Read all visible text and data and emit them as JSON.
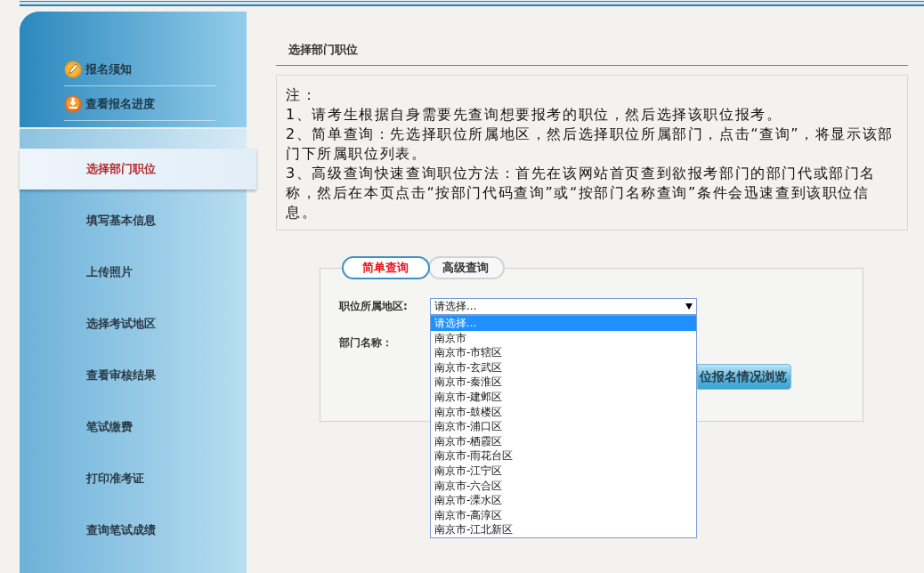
{
  "sidebar": {
    "top_links": [
      {
        "label": "报名须知",
        "kind": "pencil"
      },
      {
        "label": "查看报名进度",
        "kind": "download"
      }
    ],
    "items": [
      {
        "label": "选择部门职位",
        "selected": true
      },
      {
        "label": "填写基本信息",
        "selected": false
      },
      {
        "label": "上传照片",
        "selected": false
      },
      {
        "label": "选择考试地区",
        "selected": false
      },
      {
        "label": "查看审核结果",
        "selected": false
      },
      {
        "label": "笔试缴费",
        "selected": false
      },
      {
        "label": "打印准考证",
        "selected": false
      },
      {
        "label": "查询笔试成绩",
        "selected": false
      }
    ]
  },
  "main": {
    "title": "选择部门职位",
    "notes": {
      "heading": "注：",
      "items": [
        "1、请考生根据自身需要先查询想要报考的职位，然后选择该职位报考。",
        "2、简单查询：先选择职位所属地区，然后选择职位所属部门，点击“查询”，将显示该部门下所属职位列表。",
        "3、高级查询快速查询职位方法：首先在该网站首页查到欲报考部门的部门代或部门名称，然后在本页点击“按部门代码查询”或“按部门名称查询”条件会迅速查到该职位信息。"
      ]
    },
    "query": {
      "tabs": [
        {
          "label": "简单查询",
          "selected": true
        },
        {
          "label": "高级查询",
          "selected": false
        }
      ],
      "region_label": "职位所属地区:",
      "region_value": "请选择...",
      "department_label": "部门名称：",
      "button": "位报名情况浏览",
      "dropdown": [
        {
          "label": "请选择...",
          "selected": true
        },
        {
          "label": "南京市",
          "selected": false
        },
        {
          "label": "南京市-市辖区",
          "selected": false
        },
        {
          "label": "南京市-玄武区",
          "selected": false
        },
        {
          "label": "南京市-秦淮区",
          "selected": false
        },
        {
          "label": "南京市-建邺区",
          "selected": false
        },
        {
          "label": "南京市-鼓楼区",
          "selected": false
        },
        {
          "label": "南京市-浦口区",
          "selected": false
        },
        {
          "label": "南京市-栖霞区",
          "selected": false
        },
        {
          "label": "南京市-雨花台区",
          "selected": false
        },
        {
          "label": "南京市-江宁区",
          "selected": false
        },
        {
          "label": "南京市-六合区",
          "selected": false
        },
        {
          "label": "南京市-溧水区",
          "selected": false
        },
        {
          "label": "南京市-高淳区",
          "selected": false
        },
        {
          "label": "南京市-江北新区",
          "selected": false
        }
      ]
    }
  }
}
